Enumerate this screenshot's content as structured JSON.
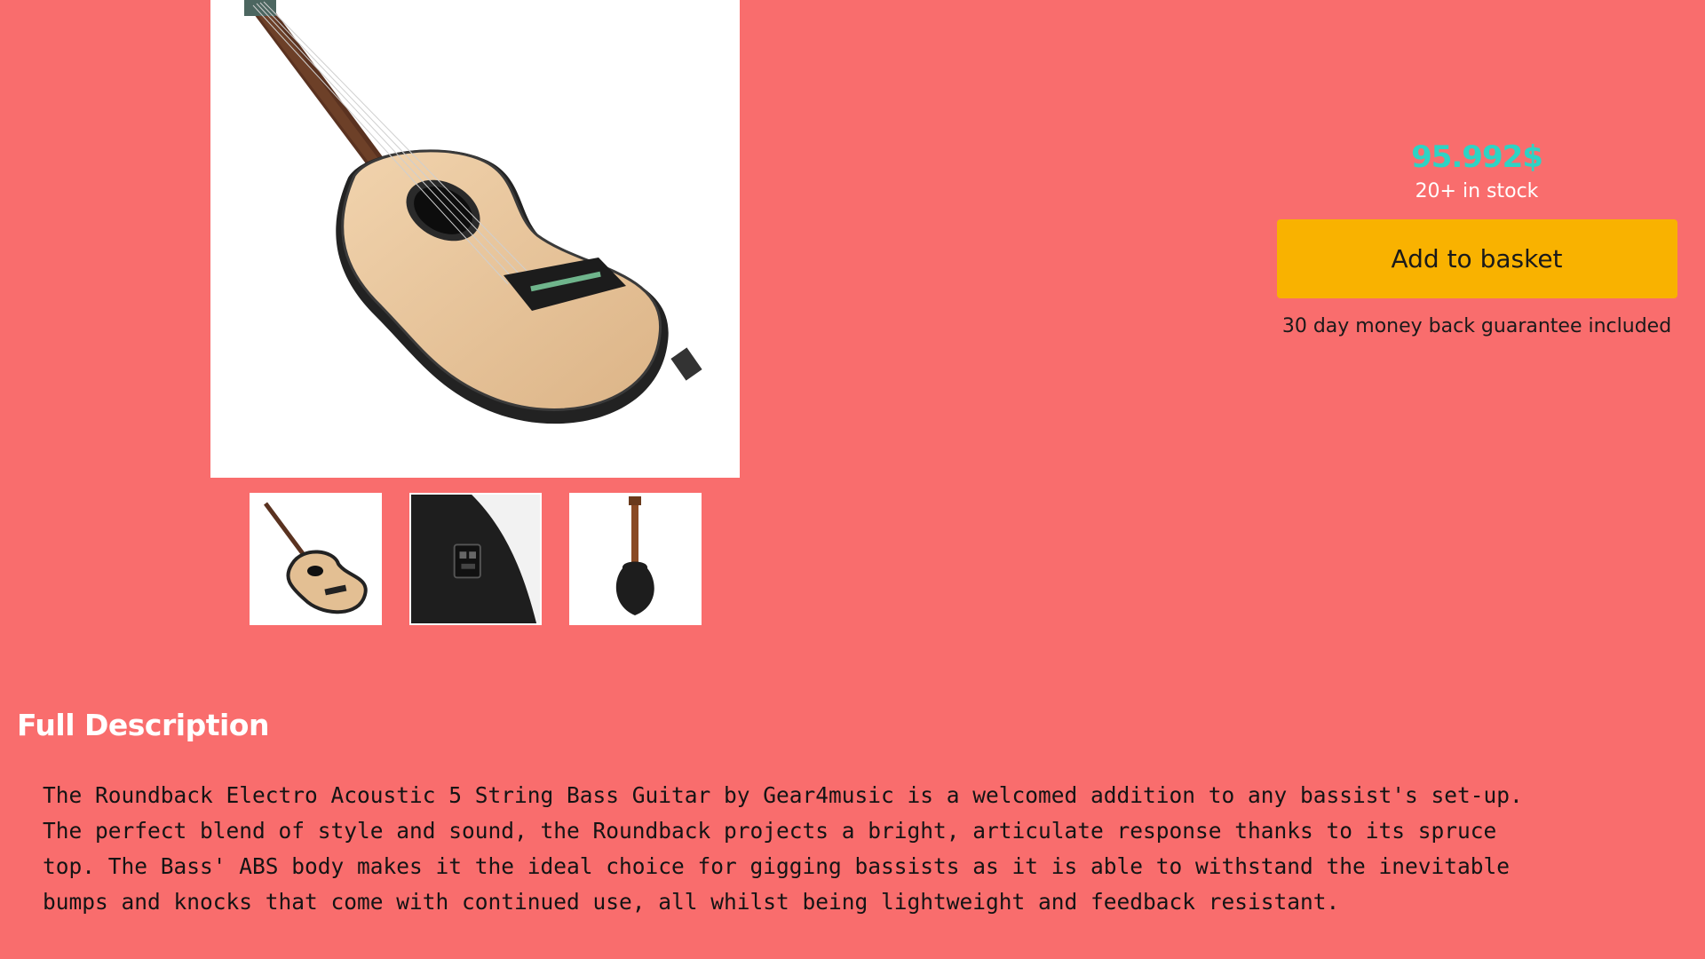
{
  "product": {
    "images": {
      "main_alt": "Roundback Electro Acoustic 5 String Bass Guitar",
      "thumbnails": [
        {
          "icon": "guitar-front-thumbnail"
        },
        {
          "icon": "guitar-preamp-closeup-thumbnail"
        },
        {
          "icon": "guitar-back-thumbnail"
        }
      ]
    },
    "price": "95.992$",
    "stock": "20+ in stock",
    "add_to_basket_label": "Add to basket",
    "guarantee": "30 day money back guarantee included"
  },
  "description": {
    "title": "Full Description",
    "lines": [
      "The Roundback Electro Acoustic 5 String Bass Guitar by Gear4music is a welcomed addition to any bassist's set-up.",
      "The perfect blend of style and sound, the Roundback projects a bright, articulate response thanks to its spruce",
      "top. The Bass' ABS body makes it the ideal choice for gigging bassists as it is able to withstand the inevitable",
      "bumps and knocks that come with continued use, all whilst being lightweight and feedback resistant."
    ]
  },
  "colors": {
    "background": "#f96d6d",
    "price": "#2ed3c4",
    "button": "#f9b200",
    "heading": "#ffffff"
  }
}
